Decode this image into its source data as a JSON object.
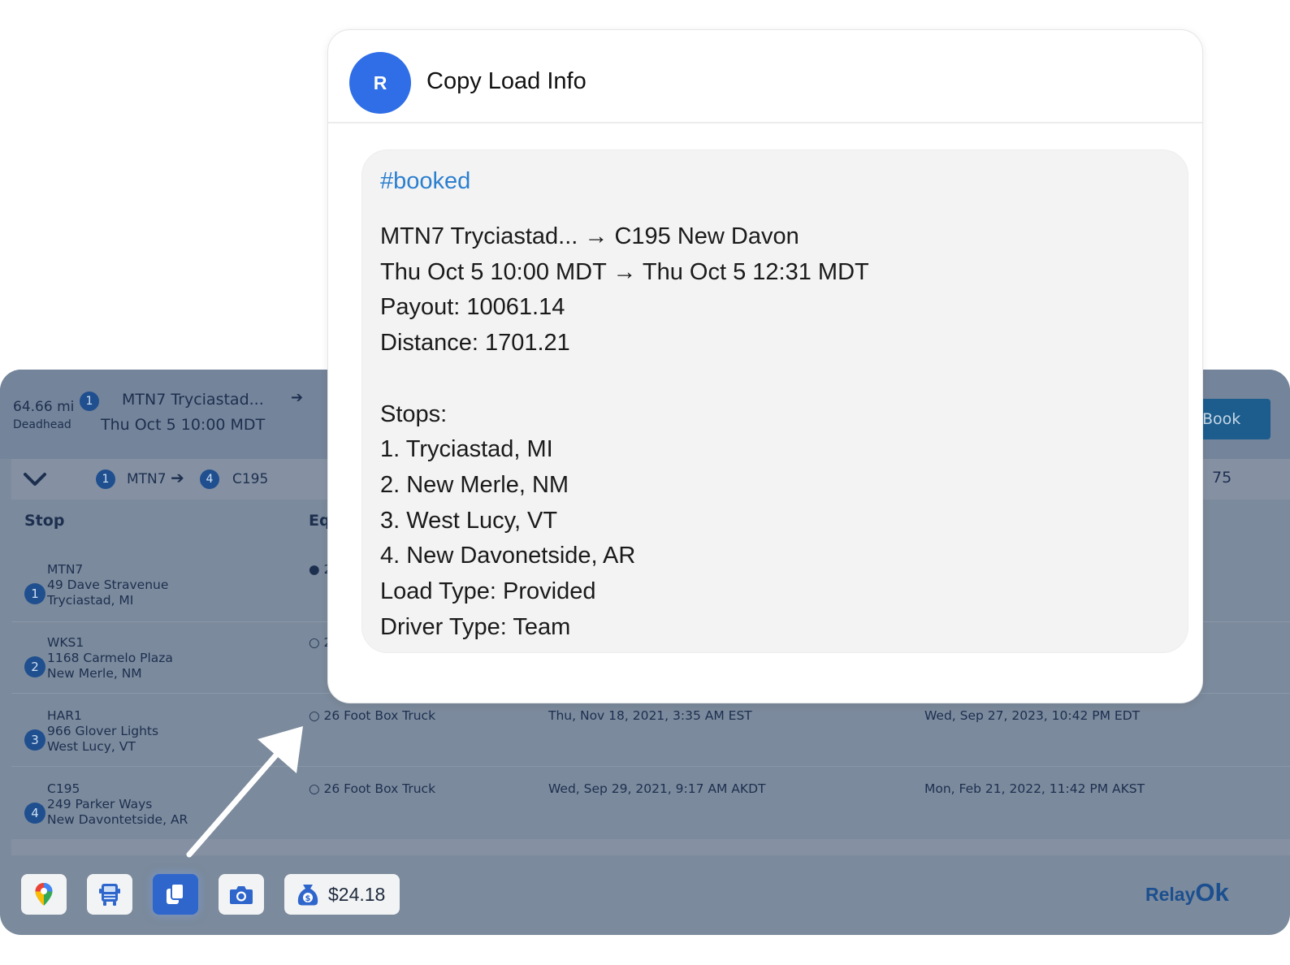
{
  "summary": {
    "deadhead_value": "64.66 mi",
    "deadhead_label": "Deadhead",
    "stop_number": "1",
    "origin": "MTN7 Tryciastad...",
    "origin_time": "Thu Oct 5 10:00 MDT",
    "arrow": "➔",
    "book_label": "Book"
  },
  "route_bar": {
    "from_number": "1",
    "from_code": "MTN7",
    "arrow": "➔",
    "to_number": "4",
    "to_code": "C195",
    "tail_text": "75"
  },
  "table": {
    "headers": {
      "stop": "Stop",
      "equipment": "Eq"
    },
    "rows": [
      {
        "num": "1",
        "code": "MTN7",
        "street": "49 Dave Stravenue",
        "city": "Tryciastad, MI",
        "equipment": "● 2",
        "date1": "",
        "date2": ""
      },
      {
        "num": "2",
        "code": "WKS1",
        "street": "1168 Carmelo Plaza",
        "city": "New Merle, NM",
        "equipment": "○ 2",
        "date1": "",
        "date2": ""
      },
      {
        "num": "3",
        "code": "HAR1",
        "street": "966 Glover Lights",
        "city": "West Lucy, VT",
        "equipment": "○ 26 Foot Box Truck",
        "date1": "Thu, Nov 18, 2021, 3:35 AM EST",
        "date2": "Wed, Sep 27, 2023, 10:42 PM EDT"
      },
      {
        "num": "4",
        "code": "C195",
        "street": "249 Parker Ways",
        "city": "New Davontetside, AR",
        "equipment": "○ 26 Foot Box Truck",
        "date1": "Wed, Sep 29, 2021, 9:17 AM AKDT",
        "date2": "Mon, Feb 21, 2022, 11:42 PM AKST"
      }
    ]
  },
  "toolbar": {
    "price": "$24.18",
    "icons": [
      "map-pin-icon",
      "truck-icon",
      "copy-icon",
      "camera-icon",
      "money-bag-icon"
    ],
    "brand_text": "Relay",
    "brand_suffix": "Ok"
  },
  "modal": {
    "avatar_letter": "R",
    "title": "Copy Load Info",
    "hashtag": "#booked",
    "lines": [
      "MTN7 Tryciastad... → C195 New Davon",
      "Thu Oct 5 10:00 MDT → Thu Oct 5 12:31 MDT",
      "Payout: 10061.14",
      "Distance: 1701.21",
      "",
      "Stops:",
      "1. Tryciastad, MI",
      "2. New Merle, NM",
      "3. West Lucy, VT",
      "4. New Davonetside, AR",
      "Load Type: Provided",
      "Driver Type: Team"
    ]
  },
  "colors": {
    "overlay_panel": "#7b8a9c",
    "accent_blue": "#2f6ee6",
    "hashtag_blue": "#2b7fcf",
    "badge_blue": "#1f4f8f"
  }
}
